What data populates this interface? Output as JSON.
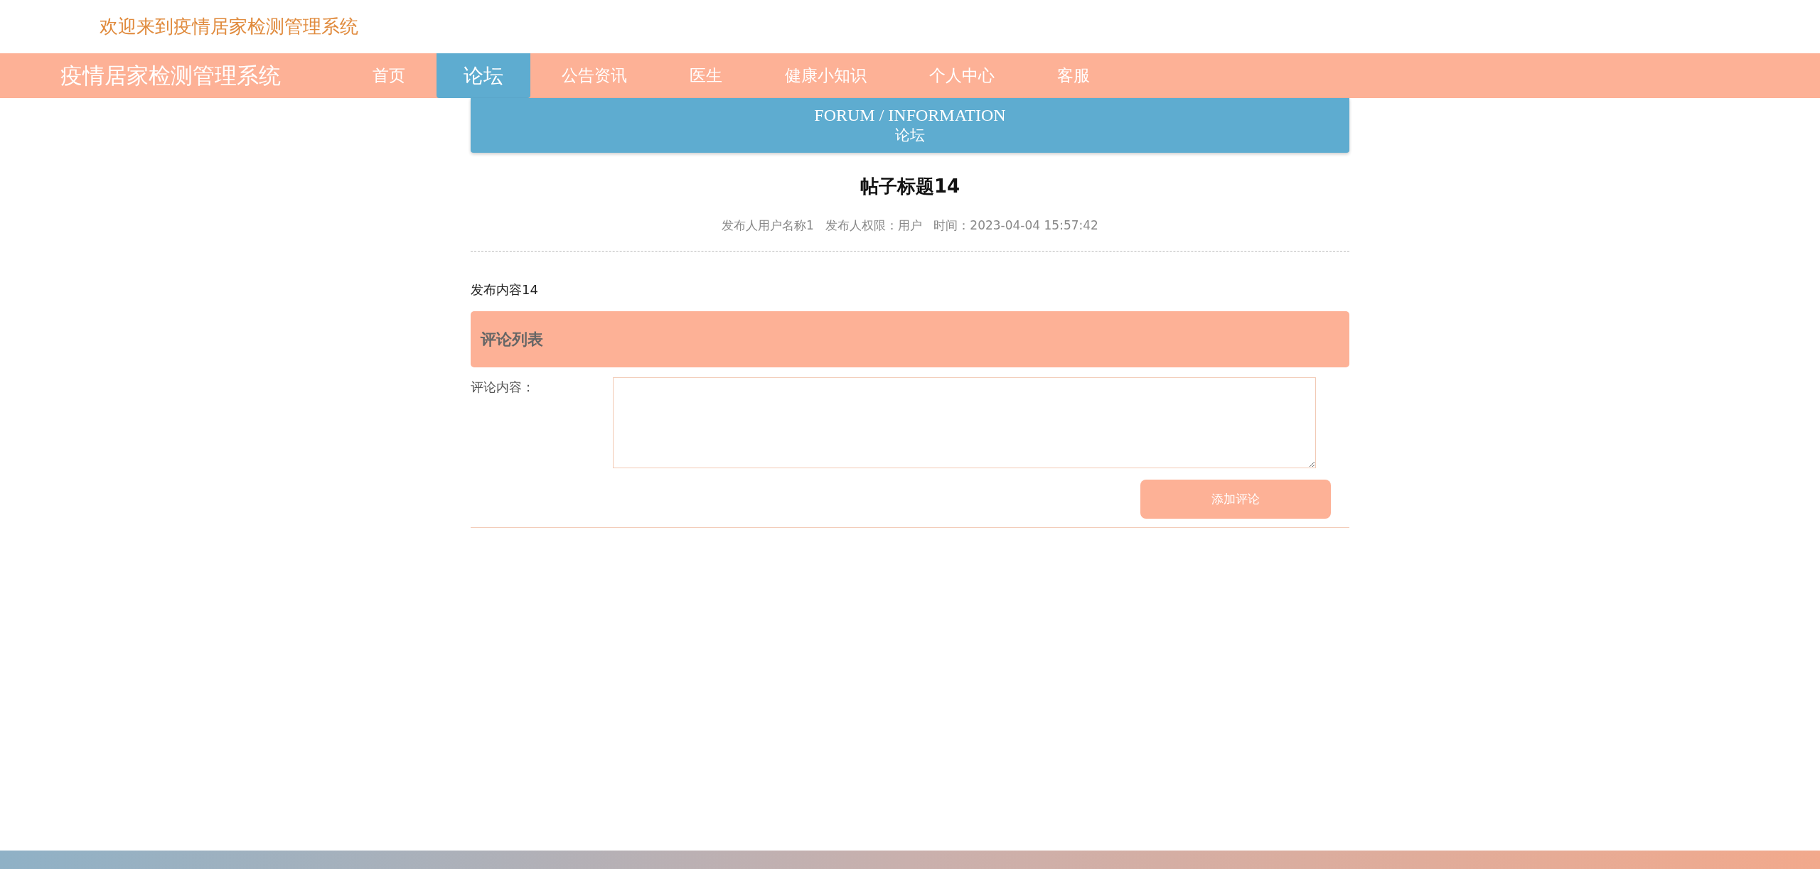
{
  "header": {
    "welcome": "欢迎来到疫情居家检测管理系统"
  },
  "nav": {
    "brand": "疫情居家检测管理系统",
    "items": [
      {
        "label": "首页",
        "selected": false
      },
      {
        "label": "论坛",
        "selected": true
      },
      {
        "label": "公告资讯",
        "selected": false
      },
      {
        "label": "医生",
        "selected": false
      },
      {
        "label": "健康小知识",
        "selected": false
      },
      {
        "label": "个人中心",
        "selected": false
      },
      {
        "label": "客服",
        "selected": false
      }
    ]
  },
  "banner": {
    "title": "FORUM / INFORMATION",
    "subtitle": "论坛"
  },
  "post": {
    "title": "帖子标题14",
    "meta": "发布人用户名称1   发布人权限：用户   时间：2023-04-04 15:57:42",
    "content": "发布内容14"
  },
  "comments": {
    "heading": "评论列表",
    "label": "评论内容：",
    "button": "添加评论"
  }
}
